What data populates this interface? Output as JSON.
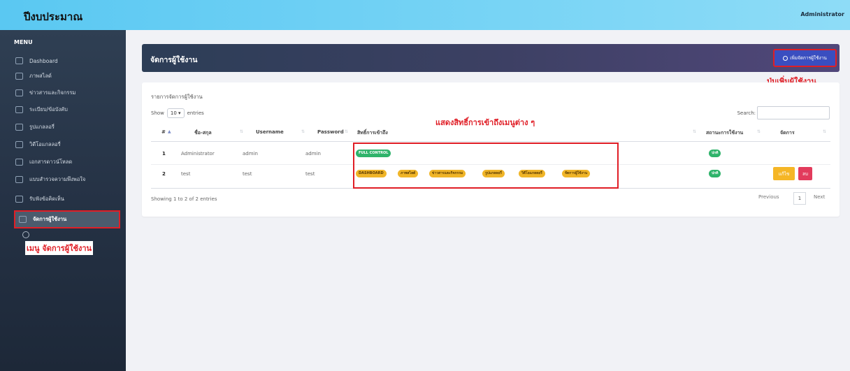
{
  "topbar": {
    "brand": "ปีงบประมาณ",
    "user": "Administrator"
  },
  "sidebar": {
    "menu_label": "MENU",
    "items": [
      {
        "label": "Dashboard",
        "icon": "monitor-icon"
      },
      {
        "label": "ภาพสไลด์",
        "icon": "image-icon"
      },
      {
        "label": "ข่าวสารและกิจกรรม",
        "icon": "news-icon"
      },
      {
        "label": "ระเบียบ/ข้อบังคับ",
        "icon": "bulb-icon"
      },
      {
        "label": "รูปแกลลอรี่",
        "icon": "gallery-icon"
      },
      {
        "label": "วิดีโอแกลลอรี่",
        "icon": "video-icon"
      },
      {
        "label": "เอกสารดาวน์โหลด",
        "icon": "download-icon"
      },
      {
        "label": "แบบสำรวจความพึงพอใจ",
        "icon": "survey-icon"
      },
      {
        "label": "รับฟังข้อคิดเห็น",
        "icon": "phone-icon"
      },
      {
        "label": "จัดการผู้ใช้งาน",
        "icon": "users-icon",
        "active": true
      }
    ],
    "annotation": "เมนู จัดการผู้ใช้งาน"
  },
  "header": {
    "title": "จัดการผู้ใช้งาน",
    "add_button": "เพิ่มจัดการผู้ใช้งาน",
    "annotation": "ปุ่มเพิ่มผู้ใช้งาน"
  },
  "table_card": {
    "title": "รายการจัดการผู้ใช้งาน",
    "show": "Show",
    "entries_value": "10",
    "entries": "entries",
    "search": "Search:",
    "annotation": "แสดงสิทธิ์การเข้าถึงเมนูต่าง ๆ",
    "columns": [
      "#",
      "ชื่อ-สกุล",
      "Username",
      "Password",
      "สิทธิ์การเข้าถึง",
      "สถานะการใช้งาน",
      "จัดการ"
    ],
    "rows": [
      {
        "no": "1",
        "name": "Administrator",
        "username": "admin",
        "password": "admin",
        "permissions": [
          "FULL CONTROL"
        ],
        "status": "ปกติ",
        "actions": []
      },
      {
        "no": "2",
        "name": "test",
        "username": "test",
        "password": "test",
        "permissions": [
          "DASHBOARD",
          "ภาพสไลด์",
          "ข่าวสารและกิจกรรม",
          "รูปแกลลอรี่",
          "วิดีโอแกลลอรี่",
          "จัดการผู้ใช้งาน"
        ],
        "status": "ปกติ",
        "actions": [
          "แก้ไข",
          "ลบ"
        ]
      }
    ],
    "info": "Showing 1 to 2 of 2 entries",
    "prev": "Previous",
    "page": "1",
    "next": "Next"
  },
  "colors": {
    "accent_red": "#e01e26",
    "badge_green": "#2fb36b",
    "badge_yellow": "#f0b528",
    "sidebar_bg": "#253245"
  }
}
